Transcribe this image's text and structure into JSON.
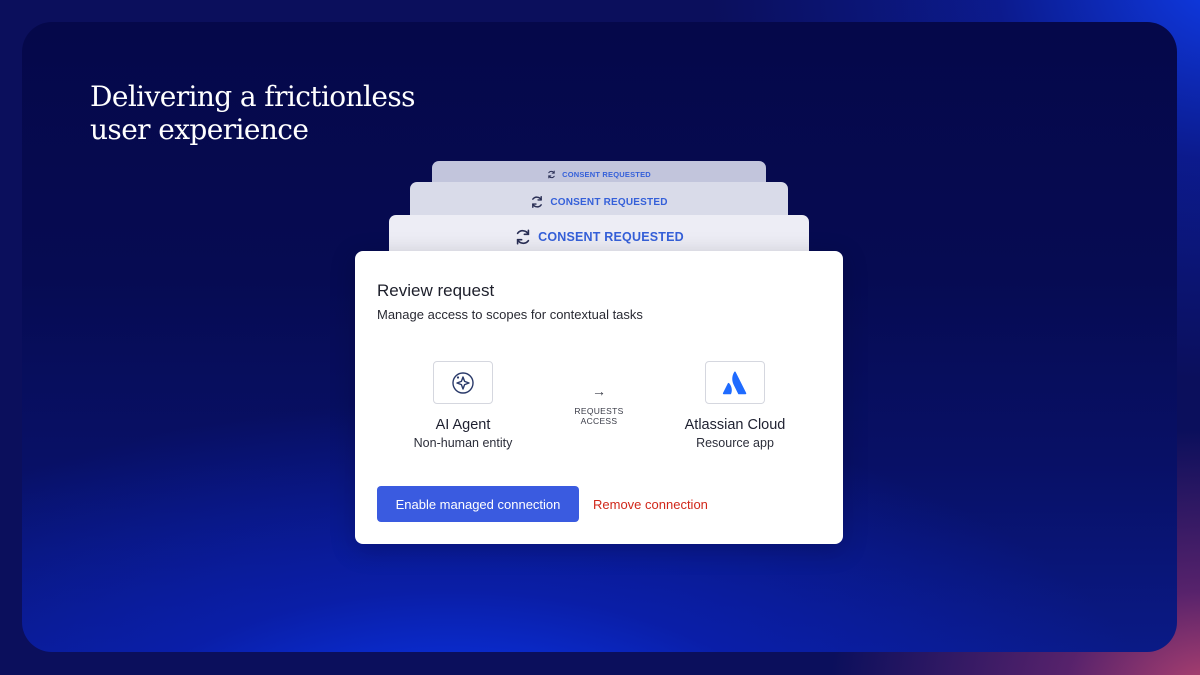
{
  "headline": "Delivering a frictionless\nuser experience",
  "consent_stack": [
    {
      "label": "CONSENT REQUESTED",
      "icon": "sync-icon"
    },
    {
      "label": "CONSENT REQUESTED",
      "icon": "sync-icon"
    },
    {
      "label": "CONSENT REQUESTED",
      "icon": "sync-icon"
    }
  ],
  "review_card": {
    "title": "Review request",
    "subtitle": "Manage access to scopes for contextual tasks",
    "requester": {
      "icon": "ai-agent-icon",
      "name": "AI Agent",
      "role": "Non-human entity"
    },
    "relation": {
      "arrow": "→",
      "label": "REQUESTS\nACCESS"
    },
    "resource": {
      "icon": "atlassian-logo-icon",
      "name": "Atlassian Cloud",
      "role": "Resource app"
    },
    "primary_action": "Enable managed connection",
    "secondary_action": "Remove connection"
  },
  "colors": {
    "accent": "#3a5be0",
    "consent_label": "#3560d9",
    "danger": "#d0271a",
    "atlassian_blue": "#1f6bff"
  }
}
